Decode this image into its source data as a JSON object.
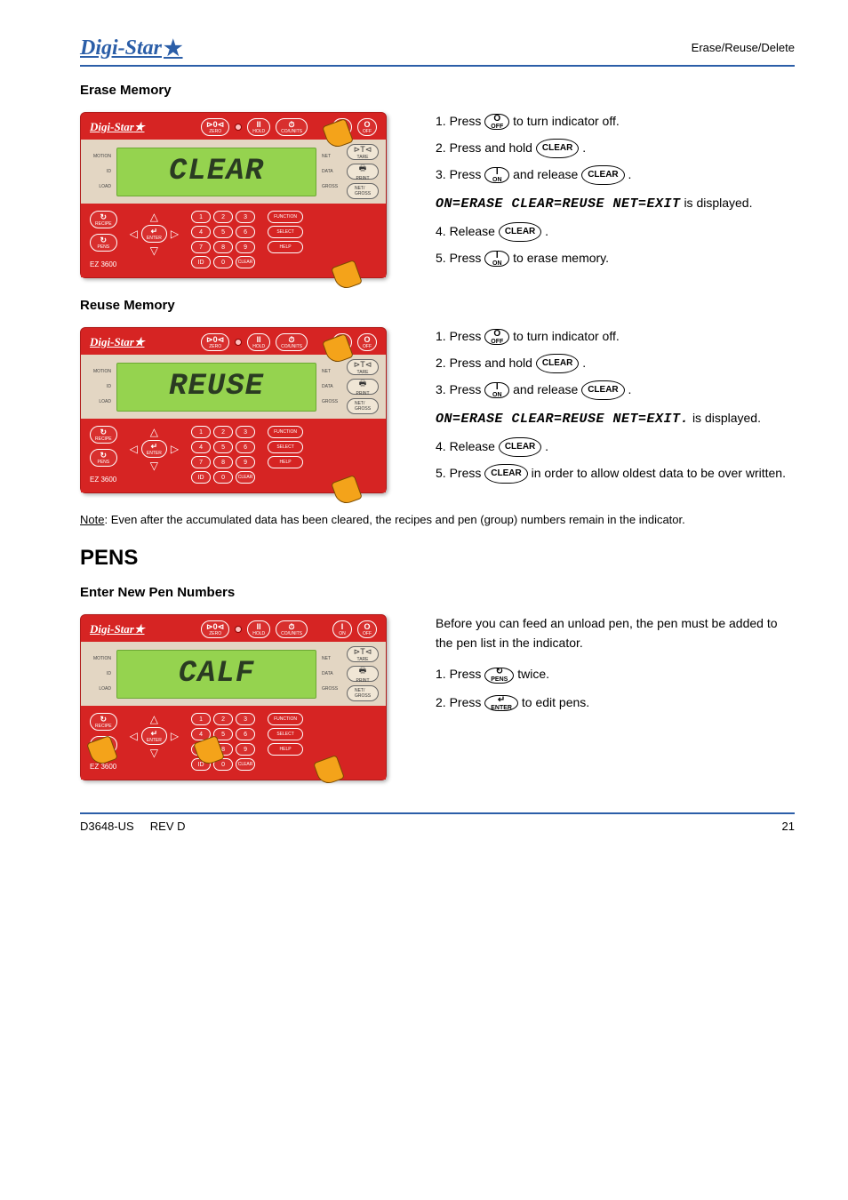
{
  "header": {
    "brand": "Digi-Star",
    "star": "★",
    "topRight": "Erase/Reuse/Delete"
  },
  "sectionA": {
    "title": "Erase Memory",
    "device": {
      "lcd": "CLEAR",
      "model": "EZ 3600"
    },
    "steps": {
      "s1a": "1. Press ",
      "s1b": " to turn indicator off.",
      "s2a": "2. Press and hold ",
      "s2b": ".",
      "s3a": "3. Press ",
      "s3b": " and release ",
      "s3c": ".",
      "scr": "ON=ERASE CLEAR=REUSE NET=EXIT",
      "scrPost": " is displayed.",
      "s4a": "4. Release ",
      "s4b": ".",
      "s5a": "5. Press ",
      "s5b": " to erase memory."
    }
  },
  "sectionB": {
    "title": "Reuse Memory",
    "device": {
      "lcd": "REUSE",
      "model": "EZ 3600"
    },
    "steps": {
      "s1a": "1. Press ",
      "s1b": " to turn indicator off.",
      "s2a": "2. Press and hold ",
      "s2b": ".",
      "s3a": "3. Press ",
      "s3b": " and release ",
      "s3c": ".",
      "scr": "ON=ERASE CLEAR=REUSE NET=EXIT.",
      "scrPost": " is displayed.",
      "s4a": "4. Release ",
      "s4b": ".",
      "s5a": "5. Press ",
      "s5b": " in order to allow oldest data to be over written."
    },
    "noteTitle": "Note",
    "noteBody": ": Even after the accumulated data has been cleared, the recipes and pen (group) numbers remain in the indicator."
  },
  "sectionC": {
    "bigTitle": "PENS",
    "subTitle": "Enter New Pen Numbers",
    "device": {
      "lcd": "CALF",
      "model": "EZ 3600"
    },
    "body": {
      "intro": "Before you can feed an unload pen, the pen must be added to the pen list in the indicator.",
      "s1a": "1. Press ",
      "s1b": " twice.",
      "s2a": "2. Press ",
      "s2b": " to edit pens."
    }
  },
  "keypad": {
    "keys": [
      "1",
      "2",
      "3",
      "4",
      "5",
      "6",
      "7",
      "8",
      "9",
      "ID",
      "0",
      "CLEAR"
    ],
    "side": [
      "FUNCTION",
      "SELECT",
      "HELP"
    ],
    "top": {
      "zero": {
        "sym": "⊳0⊲",
        "lab": "ZERO"
      },
      "hold": {
        "sym": "II",
        "lab": "HOLD"
      },
      "timer": {
        "sym": "⏱",
        "lab": "CO/UNITS"
      },
      "on": {
        "sym": "I",
        "lab": "ON"
      },
      "off": {
        "sym": "O",
        "lab": "OFF"
      }
    },
    "displayLeft": [
      "MOTION",
      "ID",
      "LOAD"
    ],
    "displayRight": [
      "NET",
      "DATA",
      "GROSS"
    ],
    "right": {
      "tare": {
        "sym": "⊳T⊲",
        "lab": "TARE"
      },
      "print": {
        "sym": "🖶",
        "lab": "PRINT"
      },
      "net": {
        "sym": "",
        "lab": "NET/\nGROSS"
      }
    },
    "left": {
      "recipe": {
        "sym": "↻",
        "lab": "RECIPE"
      },
      "pens": {
        "sym": "↻",
        "lab": "PENS"
      },
      "enter": {
        "sym": "↵",
        "lab": "ENTER"
      }
    }
  },
  "ovals": {
    "off": {
      "sym": "O",
      "lab": "OFF"
    },
    "on": {
      "sym": "I",
      "lab": "ON"
    },
    "clear": "CLEAR",
    "pens": {
      "sym": "↻",
      "lab": "PENS"
    },
    "enter": {
      "sym": "↵",
      "lab": "ENTER"
    }
  },
  "footer": {
    "left": "D3648-US",
    "right": "REV D",
    "pg": "21"
  }
}
